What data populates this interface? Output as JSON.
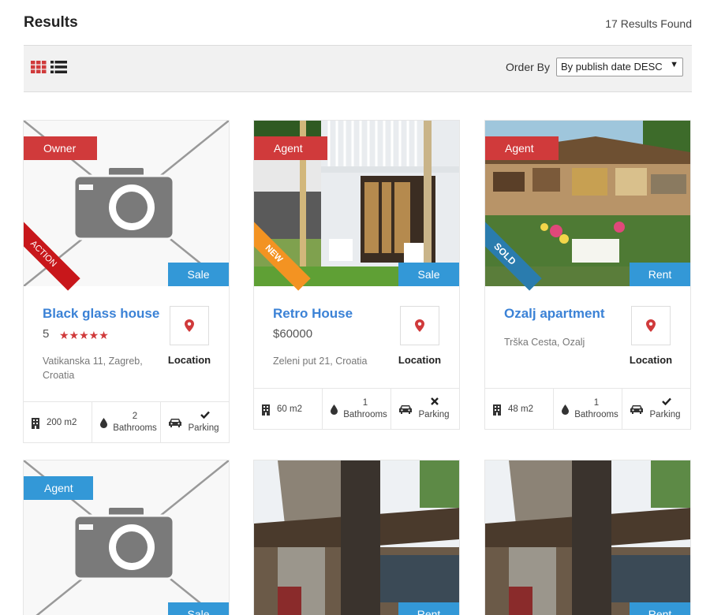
{
  "header": {
    "title": "Results",
    "results_count": "17 Results Found"
  },
  "toolbar": {
    "grid_icon": "grid-view-icon",
    "list_icon": "list-view-icon",
    "order_label": "Order By",
    "order_value": "By publish date DESC"
  },
  "colors": {
    "accent_blue": "#3398d7",
    "accent_red": "#d03a3b",
    "link_blue": "#3b82d6"
  },
  "cards": [
    {
      "tag": "Owner",
      "ribbon": "ACTION",
      "type": "Sale",
      "name": "Black glass house",
      "rating_value": "5",
      "stars": "★★★★★",
      "address": "Vatikanska 11, Zagreb, Croatia",
      "location_label": "Location",
      "area": "200 m2",
      "bathrooms_count": "2",
      "bathrooms_label": "Bathrooms",
      "parking_label": "Parking",
      "parking_icon": "check-icon"
    },
    {
      "tag": "Agent",
      "ribbon": "NEW",
      "type": "Sale",
      "name": "Retro House",
      "price": "$60000",
      "address": "Zeleni put 21, Croatia",
      "location_label": "Location",
      "area": "60 m2",
      "bathrooms_count": "1",
      "bathrooms_label": "Bathrooms",
      "parking_label": "Parking",
      "parking_icon": "cross-icon"
    },
    {
      "tag": "Agent",
      "ribbon": "SOLD",
      "type": "Rent",
      "name": "Ozalj apartment",
      "address": "Trška Cesta, Ozalj",
      "location_label": "Location",
      "area": "48 m2",
      "bathrooms_count": "1",
      "bathrooms_label": "Bathrooms",
      "parking_label": "Parking",
      "parking_icon": "check-icon"
    },
    {
      "tag": "Agent",
      "type": "Sale"
    },
    {
      "type": "Rent"
    },
    {
      "type": "Rent"
    }
  ]
}
